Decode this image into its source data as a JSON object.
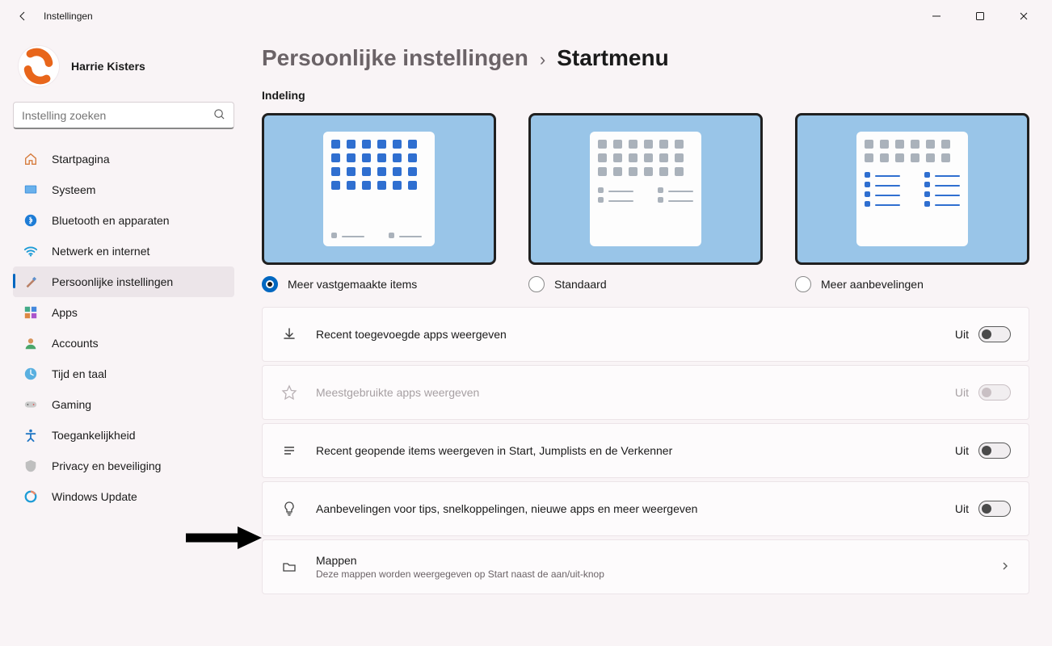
{
  "window": {
    "title": "Instellingen"
  },
  "profile": {
    "name": "Harrie Kisters"
  },
  "search": {
    "placeholder": "Instelling zoeken"
  },
  "nav": [
    {
      "id": "home",
      "label": "Startpagina"
    },
    {
      "id": "system",
      "label": "Systeem"
    },
    {
      "id": "bluetooth",
      "label": "Bluetooth en apparaten"
    },
    {
      "id": "network",
      "label": "Netwerk en internet"
    },
    {
      "id": "personalization",
      "label": "Persoonlijke instellingen",
      "active": true
    },
    {
      "id": "apps",
      "label": "Apps"
    },
    {
      "id": "accounts",
      "label": "Accounts"
    },
    {
      "id": "time",
      "label": "Tijd en taal"
    },
    {
      "id": "gaming",
      "label": "Gaming"
    },
    {
      "id": "accessibility",
      "label": "Toegankelijkheid"
    },
    {
      "id": "privacy",
      "label": "Privacy en beveiliging"
    },
    {
      "id": "update",
      "label": "Windows Update"
    }
  ],
  "breadcrumb": {
    "parent": "Persoonlijke instellingen",
    "current": "Startmenu"
  },
  "section": {
    "layout_label": "Indeling"
  },
  "layout_options": {
    "more_pinned": "Meer vastgemaakte items",
    "default": "Standaard",
    "more_recs": "Meer aanbevelingen",
    "selected": "more_pinned"
  },
  "settings": {
    "recent_apps": {
      "title": "Recent toegevoegde apps weergeven",
      "state": "Uit"
    },
    "most_used": {
      "title": "Meestgebruikte apps weergeven",
      "state": "Uit"
    },
    "recent_items": {
      "title": "Recent geopende items weergeven in Start, Jumplists en de Verkenner",
      "state": "Uit"
    },
    "recommendations": {
      "title": "Aanbevelingen voor tips, snelkoppelingen, nieuwe apps en meer weergeven",
      "state": "Uit"
    },
    "folders": {
      "title": "Mappen",
      "subtitle": "Deze mappen worden weergegeven op Start naast de aan/uit-knop"
    }
  }
}
